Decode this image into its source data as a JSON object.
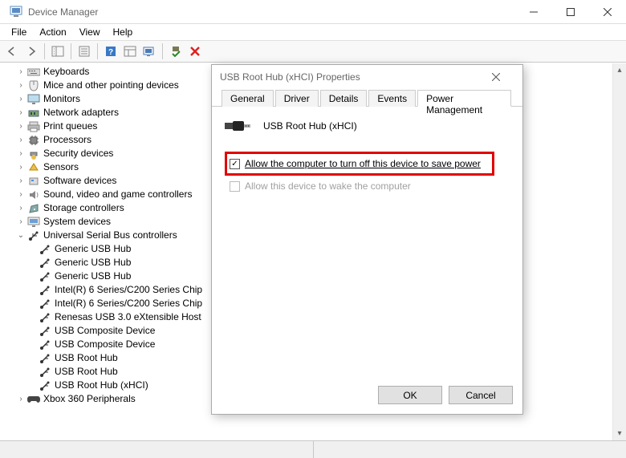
{
  "window": {
    "title": "Device Manager"
  },
  "menu": {
    "file": "File",
    "action": "Action",
    "view": "View",
    "help": "Help"
  },
  "tree": {
    "items": [
      {
        "label": "Keyboards"
      },
      {
        "label": "Mice and other pointing devices"
      },
      {
        "label": "Monitors"
      },
      {
        "label": "Network adapters"
      },
      {
        "label": "Print queues"
      },
      {
        "label": "Processors"
      },
      {
        "label": "Security devices"
      },
      {
        "label": "Sensors"
      },
      {
        "label": "Software devices"
      },
      {
        "label": "Sound, video and game controllers"
      },
      {
        "label": "Storage controllers"
      },
      {
        "label": "System devices"
      }
    ],
    "usb": {
      "label": "Universal Serial Bus controllers",
      "children": [
        "Generic USB Hub",
        "Generic USB Hub",
        "Generic USB Hub",
        "Intel(R) 6 Series/C200 Series Chip",
        "Intel(R) 6 Series/C200 Series Chip",
        "Renesas USB 3.0 eXtensible Host",
        "USB Composite Device",
        "USB Composite Device",
        "USB Root Hub",
        "USB Root Hub",
        "USB Root Hub (xHCI)"
      ]
    },
    "xbox": {
      "label": "Xbox 360 Peripherals"
    }
  },
  "dialog": {
    "title": "USB Root Hub (xHCI) Properties",
    "tabs": {
      "general": "General",
      "driver": "Driver",
      "details": "Details",
      "events": "Events",
      "power": "Power Management"
    },
    "device_name": "USB Root Hub (xHCI)",
    "check1": "Allow the computer to turn off this device to save power",
    "check2": "Allow this device to wake the computer",
    "ok": "OK",
    "cancel": "Cancel"
  }
}
